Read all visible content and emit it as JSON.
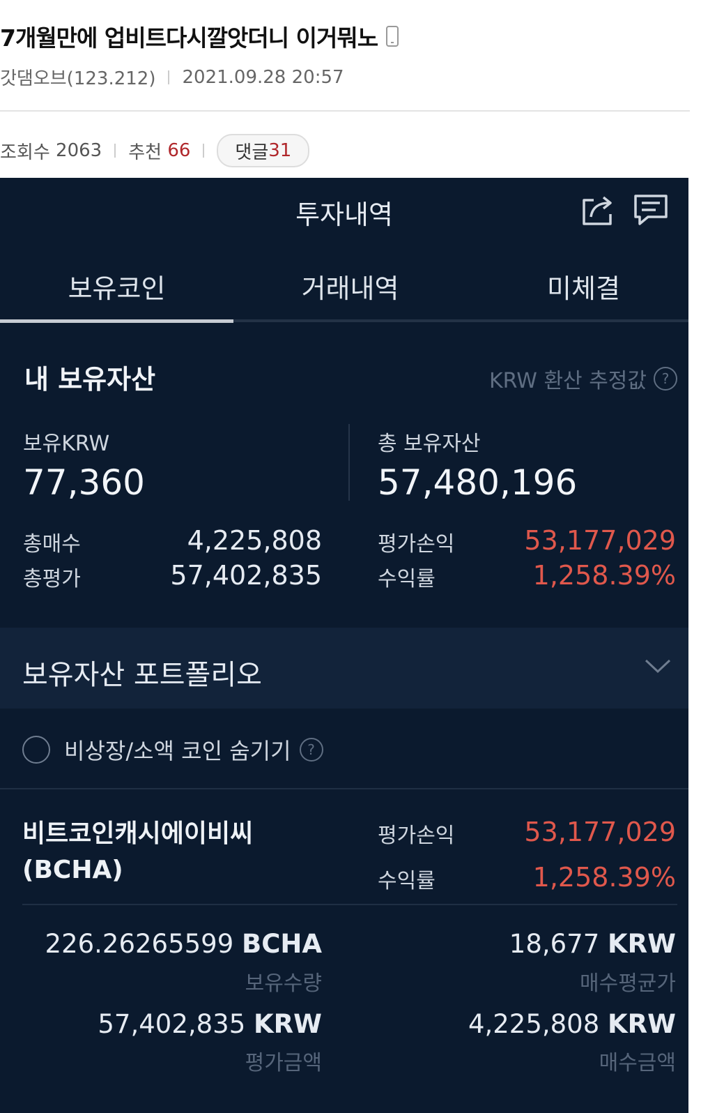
{
  "post": {
    "title": "7개월만에 업비트다시깔앗더니 이거뭐노",
    "author": "갓댐오브(123.212)",
    "date": "2021.09.28 20:57",
    "views_label": "조회수",
    "views": "2063",
    "likes_label": "추천",
    "likes": "66",
    "comments_label": "댓글",
    "comments": "31"
  },
  "app": {
    "title": "투자내역",
    "tabs": [
      "보유코인",
      "거래내역",
      "미체결"
    ],
    "assets": {
      "title": "내 보유자산",
      "krw_note": "KRW 환산 추정값",
      "help": "?",
      "krw_label": "보유KRW",
      "krw_value": "77,360",
      "total_label": "총 보유자산",
      "total_value": "57,480,196",
      "buy_label": "총매수",
      "buy_value": "4,225,808",
      "eval_label": "총평가",
      "eval_value": "57,402,835",
      "pl_label": "평가손익",
      "pl_value": "53,177,029",
      "rate_label": "수익률",
      "rate_value": "1,258.39%"
    },
    "portfolio_label": "보유자산 포트폴리오",
    "hide_label": "비상장/소액 코인 숨기기",
    "coin": {
      "name": "비트코인캐시에이비씨",
      "symbol": "(BCHA)",
      "pl_label": "평가손익",
      "pl_value": "53,177,029",
      "rate_label": "수익률",
      "rate_value": "1,258.39%",
      "qty_value": "226.26265599",
      "qty_unit": "BCHA",
      "qty_label": "보유수량",
      "avg_value": "18,677",
      "avg_unit": "KRW",
      "avg_label": "매수평균가",
      "evalamt_value": "57,402,835",
      "evalamt_unit": "KRW",
      "evalamt_label": "평가금액",
      "buyamt_value": "4,225,808",
      "buyamt_unit": "KRW",
      "buyamt_label": "매수금액"
    }
  },
  "colors": {
    "app_bg": "#0b1a2e",
    "profit": "#e0584c",
    "accent_red": "#b0272b"
  }
}
